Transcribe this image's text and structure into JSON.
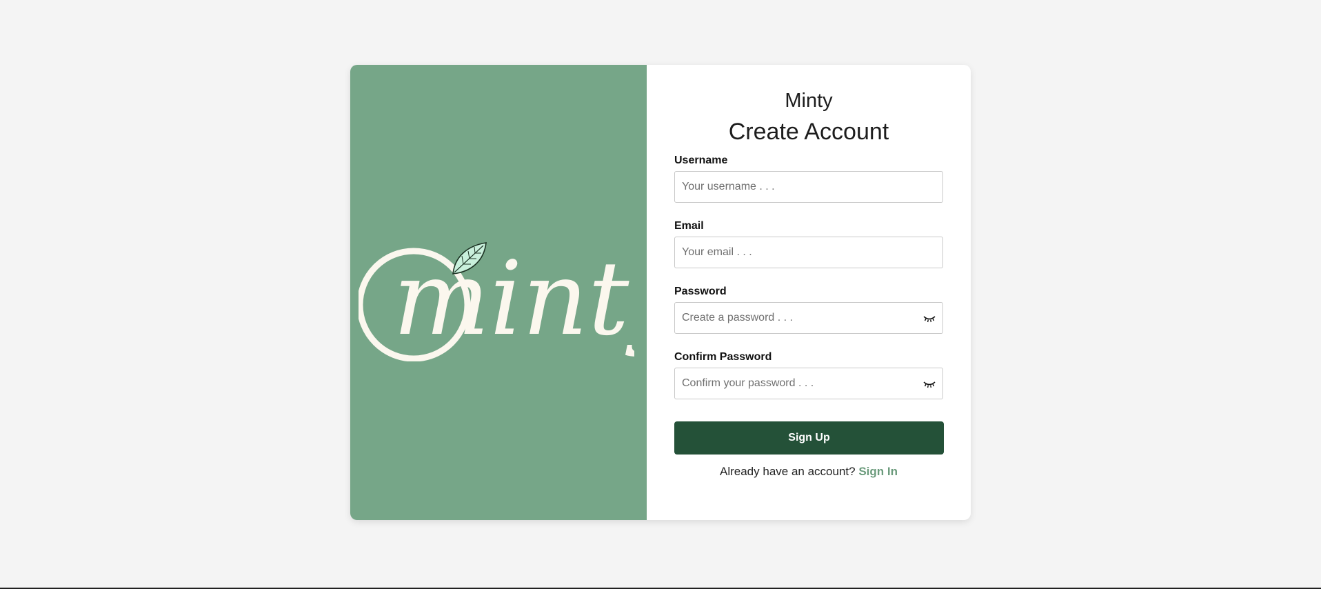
{
  "app": {
    "logo_text": "minty",
    "brand_name": "Minty"
  },
  "colors": {
    "brand_panel": "#76a688",
    "primary_button": "#245138",
    "link": "#6b9b7c",
    "leaf_fill": "#c9f0dc"
  },
  "form": {
    "title": "Create Account",
    "fields": {
      "username": {
        "label": "Username",
        "placeholder": "Your username . . .",
        "value": ""
      },
      "email": {
        "label": "Email",
        "placeholder": "Your email . . .",
        "value": ""
      },
      "password": {
        "label": "Password",
        "placeholder": "Create a password . . .",
        "value": "",
        "toggle_icon": "eye-closed-icon"
      },
      "confirm_password": {
        "label": "Confirm Password",
        "placeholder": "Confirm your password . . .",
        "value": "",
        "toggle_icon": "eye-closed-icon"
      }
    },
    "submit_label": "Sign Up",
    "signin_prompt": "Already have an account?",
    "signin_link": "Sign In"
  }
}
